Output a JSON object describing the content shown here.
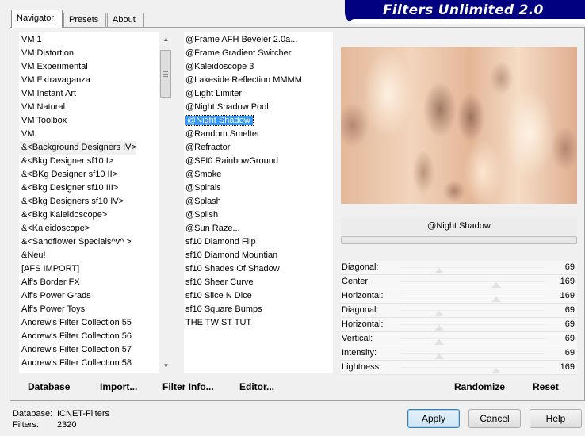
{
  "banner": {
    "title": "Filters Unlimited 2.0"
  },
  "tabs": [
    {
      "label": "Navigator",
      "active": true
    },
    {
      "label": "Presets",
      "active": false
    },
    {
      "label": "About",
      "active": false
    }
  ],
  "categories": [
    "VM 1",
    "VM Distortion",
    "VM Experimental",
    "VM Extravaganza",
    "VM Instant Art",
    "VM Natural",
    "VM Toolbox",
    "VM",
    "&<Background Designers IV>",
    "&<Bkg Designer sf10 I>",
    "&<BKg Designer sf10 II>",
    "&<Bkg Designer sf10 III>",
    "&<Bkg Designers sf10 IV>",
    "&<Bkg Kaleidoscope>",
    "&<Kaleidoscope>",
    "&<Sandflower Specials^v^ >",
    "&Neu!",
    "[AFS IMPORT]",
    "Alf's Border FX",
    "Alf's Power Grads",
    "Alf's Power Toys",
    "Andrew's Filter Collection 55",
    "Andrew's Filter Collection 56",
    "Andrew's Filter Collection 57",
    "Andrew's Filter Collection 58"
  ],
  "filters": [
    "@Frame AFH Beveler 2.0a...",
    "@Frame Gradient Switcher",
    "@Kaleidoscope 3",
    "@Lakeside Reflection MMMM",
    "@Light Limiter",
    "@Night Shadow Pool",
    "@Night Shadow",
    "@Random Smelter",
    "@Refractor",
    "@SFI0 RainbowGround",
    "@Smoke",
    "@Spirals",
    "@Splash",
    "@Splish",
    "@Sun Raze...",
    "sf10 Diamond Flip",
    "sf10 Diamond Mountian",
    "sf10 Shades Of Shadow",
    "sf10 Sheer Curve",
    "sf10 Slice N Dice",
    "sf10 Square Bumps",
    "THE TWIST TUT"
  ],
  "selected_filter_index": 6,
  "selected_category_index": 8,
  "effect": {
    "name": "@Night Shadow",
    "progress": 0
  },
  "sliders": [
    {
      "name": "Diagonal:",
      "value": "69",
      "pos": 0.27
    },
    {
      "name": "Center:",
      "value": "169",
      "pos": 0.66
    },
    {
      "name": "Horizontal:",
      "value": "169",
      "pos": 0.66
    },
    {
      "name": "Diagonal:",
      "value": "69",
      "pos": 0.27
    },
    {
      "name": "Horizontal:",
      "value": "69",
      "pos": 0.27
    },
    {
      "name": "Vertical:",
      "value": "69",
      "pos": 0.27
    },
    {
      "name": "Intensity:",
      "value": "69",
      "pos": 0.27
    },
    {
      "name": "Lightness:",
      "value": "169",
      "pos": 0.66
    }
  ],
  "buttons": {
    "database": "Database",
    "import": "Import...",
    "filter_info": "Filter Info...",
    "editor": "Editor...",
    "randomize": "Randomize",
    "reset": "Reset",
    "apply": "Apply",
    "cancel": "Cancel",
    "help": "Help"
  },
  "status": {
    "database_label": "Database:",
    "database_value": "ICNET-Filters",
    "filters_label": "Filters:",
    "filters_value": "2320"
  }
}
